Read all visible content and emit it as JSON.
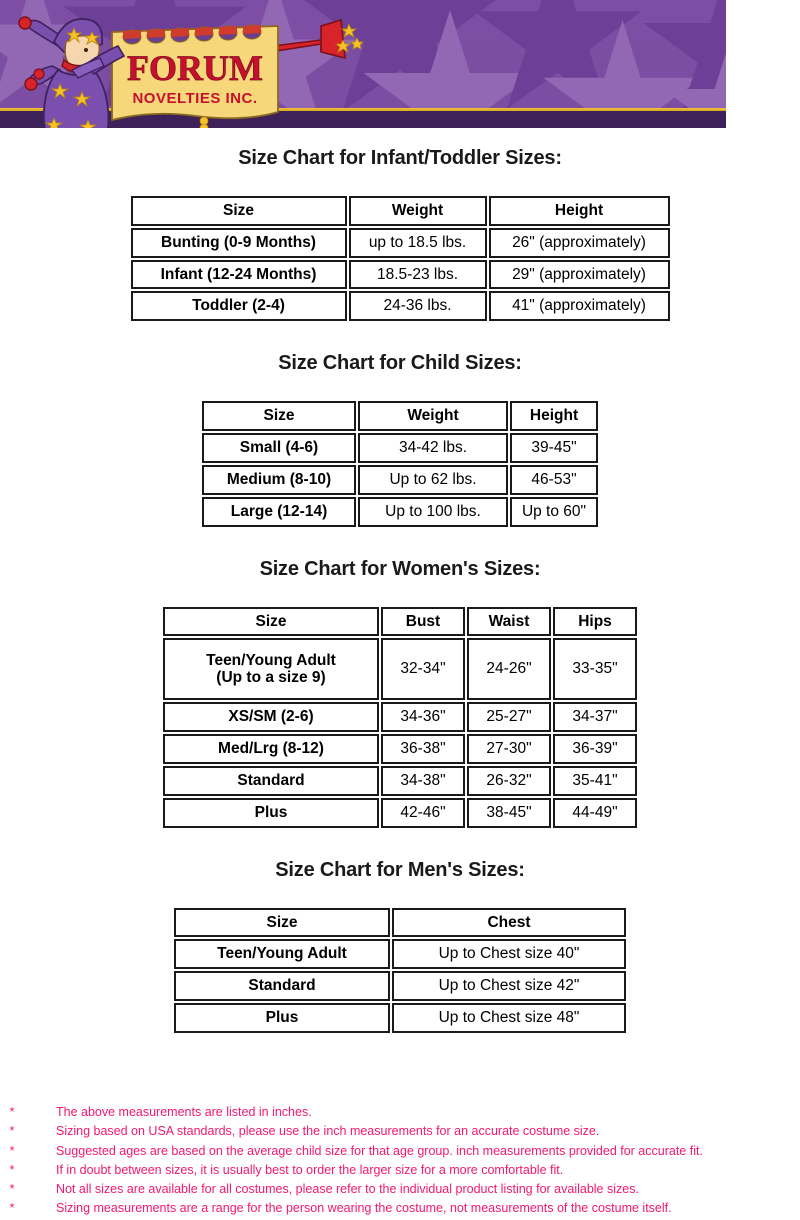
{
  "banner": {
    "logo_main": "FORUM",
    "logo_sub": "NOVELTIES INC.",
    "mascot": "jester-trumpet-mascot"
  },
  "sections": [
    {
      "title": "Size Chart for Infant/Toddler Sizes:",
      "headers": [
        "Size",
        "Weight",
        "Height"
      ],
      "rows": [
        [
          "Bunting (0-9 Months)",
          "up to 18.5 lbs.",
          "26\" (approximately)"
        ],
        [
          "Infant (12-24 Months)",
          "18.5-23 lbs.",
          "29\" (approximately)"
        ],
        [
          "Toddler (2-4)",
          "24-36 lbs.",
          "41\" (approximately)"
        ]
      ]
    },
    {
      "title": "Size Chart for Child Sizes:",
      "headers": [
        "Size",
        "Weight",
        "Height"
      ],
      "rows": [
        [
          "Small (4-6)",
          "34-42 lbs.",
          "39-45\""
        ],
        [
          "Medium (8-10)",
          "Up to 62 lbs.",
          "46-53\""
        ],
        [
          "Large (12-14)",
          "Up to 100 lbs.",
          "Up to 60\""
        ]
      ]
    },
    {
      "title": "Size Chart for Women's Sizes:",
      "headers": [
        "Size",
        "Bust",
        "Waist",
        "Hips"
      ],
      "rows": [
        [
          "Teen/Young Adult\n(Up to a size 9)",
          "32-34\"",
          "24-26\"",
          "33-35\""
        ],
        [
          "XS/SM (2-6)",
          "34-36\"",
          "25-27\"",
          "34-37\""
        ],
        [
          "Med/Lrg (8-12)",
          "36-38\"",
          "27-30\"",
          "36-39\""
        ],
        [
          "Standard",
          "34-38\"",
          "26-32\"",
          "35-41\""
        ],
        [
          "Plus",
          "42-46\"",
          "38-45\"",
          "44-49\""
        ]
      ]
    },
    {
      "title": "Size Chart for Men's Sizes:",
      "headers": [
        "Size",
        "Chest"
      ],
      "rows": [
        [
          "Teen/Young Adult",
          "Up to Chest size 40\""
        ],
        [
          "Standard",
          "Up to Chest size 42\""
        ],
        [
          "Plus",
          "Up to Chest size 48\""
        ]
      ]
    }
  ],
  "notes": {
    "bullet": "*",
    "items": [
      "The above measurements are listed in inches.",
      "Sizing based on USA standards, please use the inch measurements for an accurate costume size.",
      "Suggested ages are based on the average child size for that age group. inch measurements provided for accurate fit.",
      "If in doubt between sizes, it is usually best to order the larger size for a more comfortable fit.",
      "Not all sizes are available for all costumes, please refer to the individual product listing for available sizes.",
      "Sizing measurements are a range for the person wearing the costume, not measurements of the costume itself."
    ]
  },
  "colors": {
    "banner_purple": "#7d4ea3",
    "banner_dark_purple": "#3d2259",
    "banner_gold_line": "#e0b22a",
    "scroll_gold": "#f6d77a",
    "logo_red": "#c8102e",
    "note_pink": "#f5186e",
    "table_border": "#1a1a1a"
  }
}
